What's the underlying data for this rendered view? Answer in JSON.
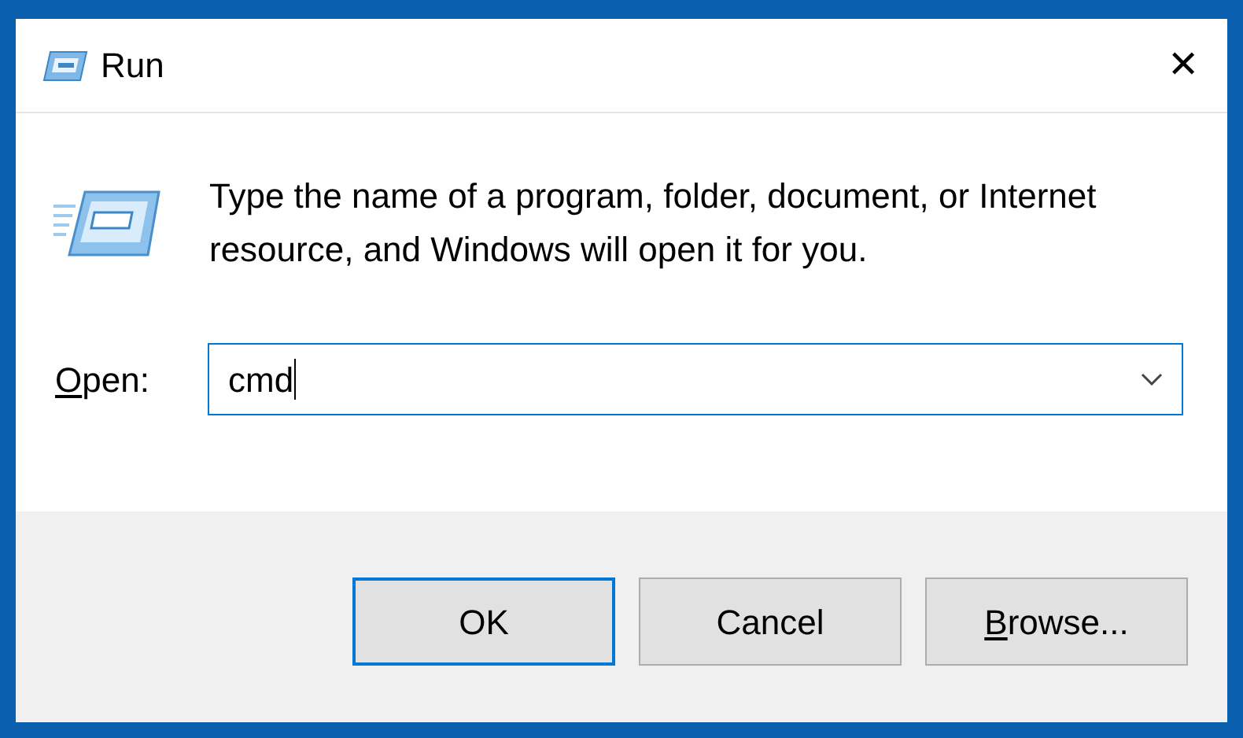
{
  "window": {
    "title": "Run",
    "close": "✕"
  },
  "description": "Type the name of a program, folder, document, or Internet resource, and Windows will open it for you.",
  "open_field": {
    "label": {
      "access_key": "O",
      "rest": "pen:"
    },
    "value": "cmd",
    "focused": true
  },
  "buttons": [
    {
      "label": {
        "rest": "OK"
      },
      "default": true
    },
    {
      "label": {
        "rest": "Cancel"
      },
      "default": false
    },
    {
      "label": {
        "access_key": "B",
        "rest": "rowse..."
      },
      "default": false
    }
  ]
}
